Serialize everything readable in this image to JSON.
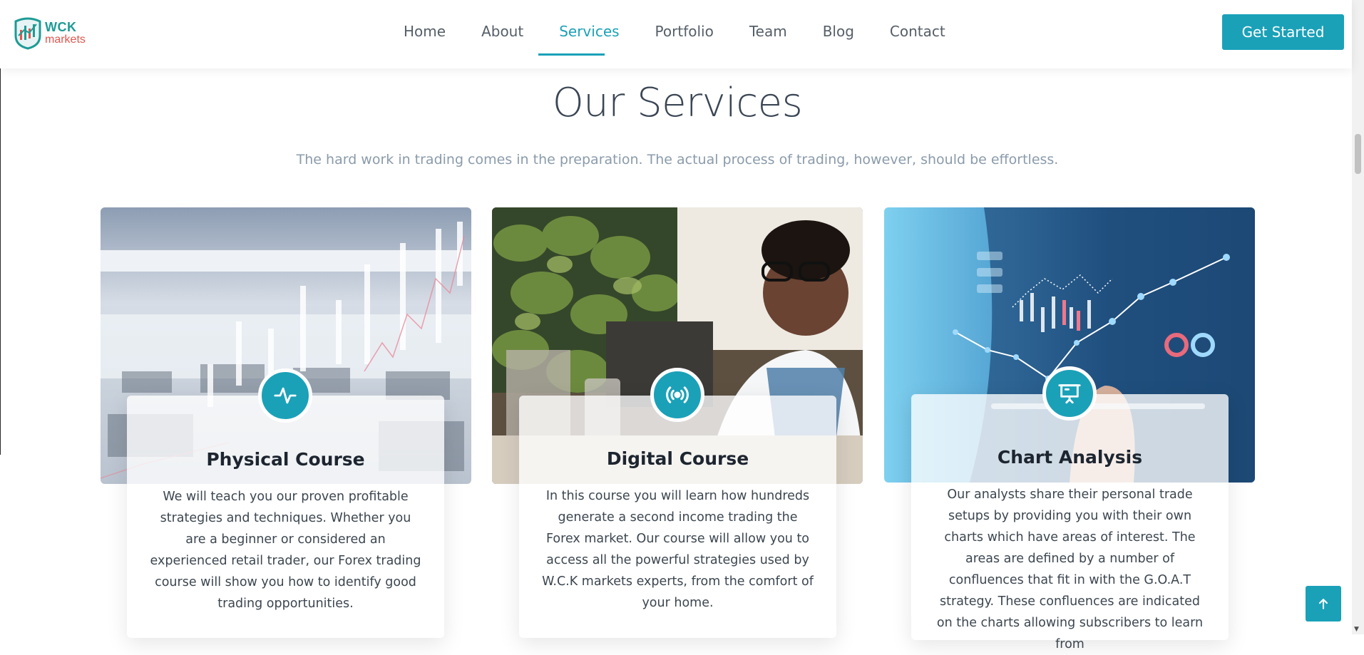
{
  "header": {
    "logo_top": "WCK",
    "logo_bottom": "markets",
    "nav": [
      {
        "label": "Home"
      },
      {
        "label": "About"
      },
      {
        "label": "Services"
      },
      {
        "label": "Portfolio"
      },
      {
        "label": "Team"
      },
      {
        "label": "Blog"
      },
      {
        "label": "Contact"
      }
    ],
    "active_nav": "Services",
    "cta_label": "Get Started"
  },
  "services": {
    "title": "Our Services",
    "subtitle": "The hard work in trading comes in the preparation. The actual process of trading, however, should be effortless.",
    "cards": [
      {
        "icon": "activity-icon",
        "title": "Physical Course",
        "text": "We will teach you our proven profitable strategies and techniques. Whether you are a beginner or considered an experienced retail trader, our Forex trading course will show you how to identify good trading opportunities."
      },
      {
        "icon": "broadcast-icon",
        "title": "Digital Course",
        "text": "In this course you will learn how hundreds generate a second income trading the Forex market. Our course will allow you to access all the powerful strategies used by W.C.K markets experts, from the comfort of your home."
      },
      {
        "icon": "presentation-icon",
        "title": "Chart Analysis",
        "text": "Our analysts share their personal trade setups by providing you with their own charts which have areas of interest. The areas are defined by a number of confluences that fit in with the G.O.A.T strategy. These confluences are indicated on the charts allowing subscribers to learn from"
      }
    ]
  },
  "colors": {
    "accent": "#1aa1b8",
    "title": "#3a4654",
    "subtitle": "#8a9bab"
  }
}
